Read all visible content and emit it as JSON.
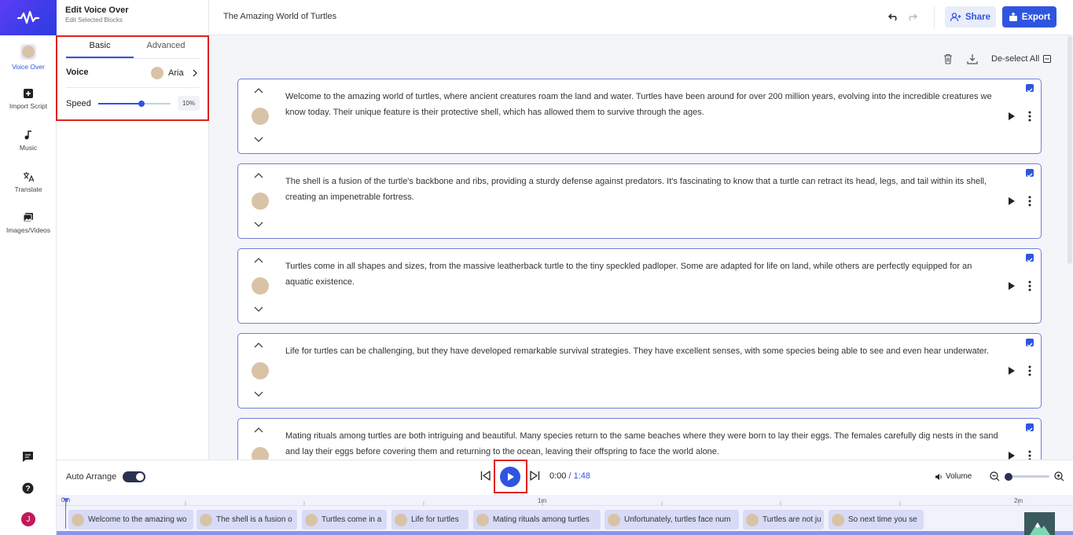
{
  "app": {
    "panel_title": "Edit Voice Over",
    "panel_subtitle": "Edit Selected Blocks"
  },
  "nav": {
    "items": [
      {
        "label": "Voice Over",
        "icon": "avatar-icon"
      },
      {
        "label": "Import Script",
        "icon": "plus-square-icon"
      },
      {
        "label": "Music",
        "icon": "music-note-icon"
      },
      {
        "label": "Translate",
        "icon": "translate-icon"
      },
      {
        "label": "Images/Videos",
        "icon": "image-stack-icon"
      }
    ],
    "user_initial": "J"
  },
  "panel": {
    "tabs": [
      "Basic",
      "Advanced"
    ],
    "voice_label": "Voice",
    "voice_name": "Aria",
    "speed_label": "Speed",
    "speed_value": "10%",
    "speed_level": 0.6
  },
  "header": {
    "doc_title": "The Amazing World of Turtles",
    "share_label": "Share",
    "export_label": "Export"
  },
  "toolbar": {
    "deselect_label": "De-select All"
  },
  "blocks": [
    {
      "text": "Welcome to the amazing world of turtles, where ancient creatures roam the land and water. Turtles have been around for over 200 million years, evolving into the incredible creatures we know today. Their unique feature is their protective shell, which has allowed them to survive through the ages."
    },
    {
      "text": "The shell is a fusion of the turtle's backbone and ribs, providing a sturdy defense against predators. It's fascinating to know that a turtle can retract its head, legs, and tail within its shell, creating an impenetrable fortress."
    },
    {
      "text": "Turtles come in all shapes and sizes, from the massive leatherback turtle to the tiny speckled padloper. Some are adapted for life on land, while others are perfectly equipped for an aquatic existence."
    },
    {
      "text": "Life for turtles can be challenging, but they have developed remarkable survival strategies. They have excellent senses, with some species being able to see and even hear underwater."
    },
    {
      "text": "Mating rituals among turtles are both intriguing and beautiful. Many species return to the same beaches where they were born to lay their eggs. The females carefully dig nests in the sand and lay their eggs before covering them and returning to the ocean, leaving their offspring to face the world alone."
    }
  ],
  "player": {
    "auto_arrange_label": "Auto Arrange",
    "current_time": "0:00",
    "separator": " / ",
    "total_time": "1:48",
    "volume_label": "Volume",
    "zoom_level": 0.0
  },
  "timeline": {
    "markers": [
      "0m",
      "1m",
      "2m"
    ],
    "clips": [
      "Welcome to the amazing wo",
      "The shell is a fusion o",
      "Turtles come in a",
      "Life for turtles",
      "Mating rituals among turtles",
      "Unfortunately, turtles face num",
      "Turtles are not ju",
      "So next time you se"
    ]
  },
  "colors": {
    "accent": "#2f55e0",
    "highlight_box": "#e02020"
  }
}
